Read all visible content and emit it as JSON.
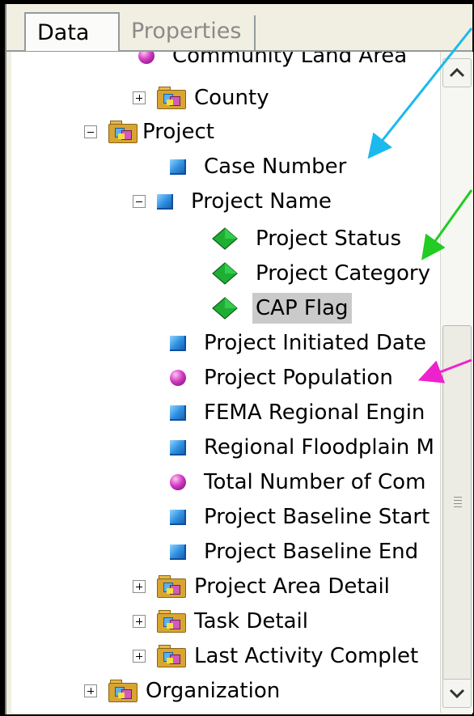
{
  "tabs": [
    {
      "label": "Data",
      "active": true
    },
    {
      "label": "Properties",
      "active": false
    }
  ],
  "tree": {
    "items": [
      {
        "label": "Community Land Area",
        "icon": "sphere",
        "expander": null
      },
      {
        "label": "County",
        "icon": "folder",
        "expander": "plus"
      },
      {
        "label": "Project",
        "icon": "folder",
        "expander": "minus"
      },
      {
        "label": "Case Number",
        "icon": "cube",
        "expander": null
      },
      {
        "label": "Project Name",
        "icon": "cube",
        "expander": "minus"
      },
      {
        "label": "Project Status",
        "icon": "diamond",
        "expander": null
      },
      {
        "label": "Project Category",
        "icon": "diamond",
        "expander": null
      },
      {
        "label": "CAP Flag",
        "icon": "diamond",
        "expander": null,
        "selected": true
      },
      {
        "label": "Project Initiated Date",
        "icon": "cube",
        "expander": null
      },
      {
        "label": "Project Population",
        "icon": "sphere",
        "expander": null
      },
      {
        "label": "FEMA Regional Engin",
        "icon": "cube",
        "expander": null
      },
      {
        "label": "Regional Floodplain M",
        "icon": "cube",
        "expander": null
      },
      {
        "label": "Total Number of Com",
        "icon": "sphere",
        "expander": null
      },
      {
        "label": "Project Baseline Start",
        "icon": "cube",
        "expander": null
      },
      {
        "label": "Project Baseline End",
        "icon": "cube",
        "expander": null
      },
      {
        "label": "Project Area Detail",
        "icon": "folder",
        "expander": "plus"
      },
      {
        "label": "Task Detail",
        "icon": "folder",
        "expander": "plus"
      },
      {
        "label": "Last Activity Complet",
        "icon": "folder",
        "expander": "plus"
      },
      {
        "label": "Organization",
        "icon": "folder",
        "expander": "plus"
      }
    ]
  },
  "scrollbar": {
    "up_icon": "chevron-up-icon",
    "down_icon": "chevron-down-icon"
  },
  "annotations": {
    "cyan_arrow_color": "#1ab9ee",
    "green_arrow_color": "#22cc22",
    "magenta_arrow_color": "#ee22cc"
  }
}
